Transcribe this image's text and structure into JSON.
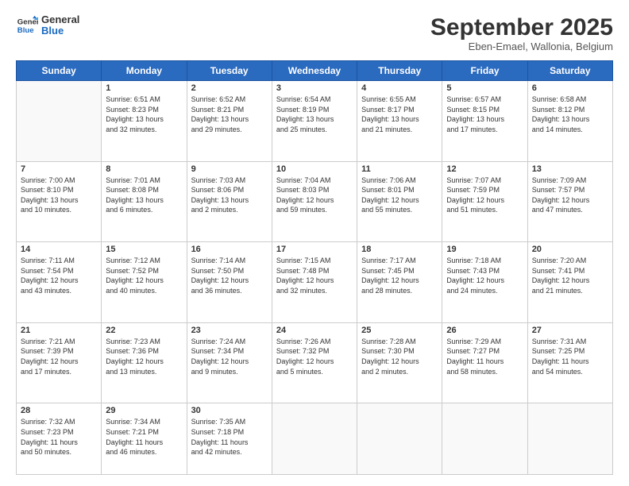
{
  "logo": {
    "line1": "General",
    "line2": "Blue"
  },
  "title": "September 2025",
  "subtitle": "Eben-Emael, Wallonia, Belgium",
  "weekdays": [
    "Sunday",
    "Monday",
    "Tuesday",
    "Wednesday",
    "Thursday",
    "Friday",
    "Saturday"
  ],
  "weeks": [
    [
      {
        "day": "",
        "info": ""
      },
      {
        "day": "1",
        "info": "Sunrise: 6:51 AM\nSunset: 8:23 PM\nDaylight: 13 hours\nand 32 minutes."
      },
      {
        "day": "2",
        "info": "Sunrise: 6:52 AM\nSunset: 8:21 PM\nDaylight: 13 hours\nand 29 minutes."
      },
      {
        "day": "3",
        "info": "Sunrise: 6:54 AM\nSunset: 8:19 PM\nDaylight: 13 hours\nand 25 minutes."
      },
      {
        "day": "4",
        "info": "Sunrise: 6:55 AM\nSunset: 8:17 PM\nDaylight: 13 hours\nand 21 minutes."
      },
      {
        "day": "5",
        "info": "Sunrise: 6:57 AM\nSunset: 8:15 PM\nDaylight: 13 hours\nand 17 minutes."
      },
      {
        "day": "6",
        "info": "Sunrise: 6:58 AM\nSunset: 8:12 PM\nDaylight: 13 hours\nand 14 minutes."
      }
    ],
    [
      {
        "day": "7",
        "info": "Sunrise: 7:00 AM\nSunset: 8:10 PM\nDaylight: 13 hours\nand 10 minutes."
      },
      {
        "day": "8",
        "info": "Sunrise: 7:01 AM\nSunset: 8:08 PM\nDaylight: 13 hours\nand 6 minutes."
      },
      {
        "day": "9",
        "info": "Sunrise: 7:03 AM\nSunset: 8:06 PM\nDaylight: 13 hours\nand 2 minutes."
      },
      {
        "day": "10",
        "info": "Sunrise: 7:04 AM\nSunset: 8:03 PM\nDaylight: 12 hours\nand 59 minutes."
      },
      {
        "day": "11",
        "info": "Sunrise: 7:06 AM\nSunset: 8:01 PM\nDaylight: 12 hours\nand 55 minutes."
      },
      {
        "day": "12",
        "info": "Sunrise: 7:07 AM\nSunset: 7:59 PM\nDaylight: 12 hours\nand 51 minutes."
      },
      {
        "day": "13",
        "info": "Sunrise: 7:09 AM\nSunset: 7:57 PM\nDaylight: 12 hours\nand 47 minutes."
      }
    ],
    [
      {
        "day": "14",
        "info": "Sunrise: 7:11 AM\nSunset: 7:54 PM\nDaylight: 12 hours\nand 43 minutes."
      },
      {
        "day": "15",
        "info": "Sunrise: 7:12 AM\nSunset: 7:52 PM\nDaylight: 12 hours\nand 40 minutes."
      },
      {
        "day": "16",
        "info": "Sunrise: 7:14 AM\nSunset: 7:50 PM\nDaylight: 12 hours\nand 36 minutes."
      },
      {
        "day": "17",
        "info": "Sunrise: 7:15 AM\nSunset: 7:48 PM\nDaylight: 12 hours\nand 32 minutes."
      },
      {
        "day": "18",
        "info": "Sunrise: 7:17 AM\nSunset: 7:45 PM\nDaylight: 12 hours\nand 28 minutes."
      },
      {
        "day": "19",
        "info": "Sunrise: 7:18 AM\nSunset: 7:43 PM\nDaylight: 12 hours\nand 24 minutes."
      },
      {
        "day": "20",
        "info": "Sunrise: 7:20 AM\nSunset: 7:41 PM\nDaylight: 12 hours\nand 21 minutes."
      }
    ],
    [
      {
        "day": "21",
        "info": "Sunrise: 7:21 AM\nSunset: 7:39 PM\nDaylight: 12 hours\nand 17 minutes."
      },
      {
        "day": "22",
        "info": "Sunrise: 7:23 AM\nSunset: 7:36 PM\nDaylight: 12 hours\nand 13 minutes."
      },
      {
        "day": "23",
        "info": "Sunrise: 7:24 AM\nSunset: 7:34 PM\nDaylight: 12 hours\nand 9 minutes."
      },
      {
        "day": "24",
        "info": "Sunrise: 7:26 AM\nSunset: 7:32 PM\nDaylight: 12 hours\nand 5 minutes."
      },
      {
        "day": "25",
        "info": "Sunrise: 7:28 AM\nSunset: 7:30 PM\nDaylight: 12 hours\nand 2 minutes."
      },
      {
        "day": "26",
        "info": "Sunrise: 7:29 AM\nSunset: 7:27 PM\nDaylight: 11 hours\nand 58 minutes."
      },
      {
        "day": "27",
        "info": "Sunrise: 7:31 AM\nSunset: 7:25 PM\nDaylight: 11 hours\nand 54 minutes."
      }
    ],
    [
      {
        "day": "28",
        "info": "Sunrise: 7:32 AM\nSunset: 7:23 PM\nDaylight: 11 hours\nand 50 minutes."
      },
      {
        "day": "29",
        "info": "Sunrise: 7:34 AM\nSunset: 7:21 PM\nDaylight: 11 hours\nand 46 minutes."
      },
      {
        "day": "30",
        "info": "Sunrise: 7:35 AM\nSunset: 7:18 PM\nDaylight: 11 hours\nand 42 minutes."
      },
      {
        "day": "",
        "info": ""
      },
      {
        "day": "",
        "info": ""
      },
      {
        "day": "",
        "info": ""
      },
      {
        "day": "",
        "info": ""
      }
    ]
  ]
}
